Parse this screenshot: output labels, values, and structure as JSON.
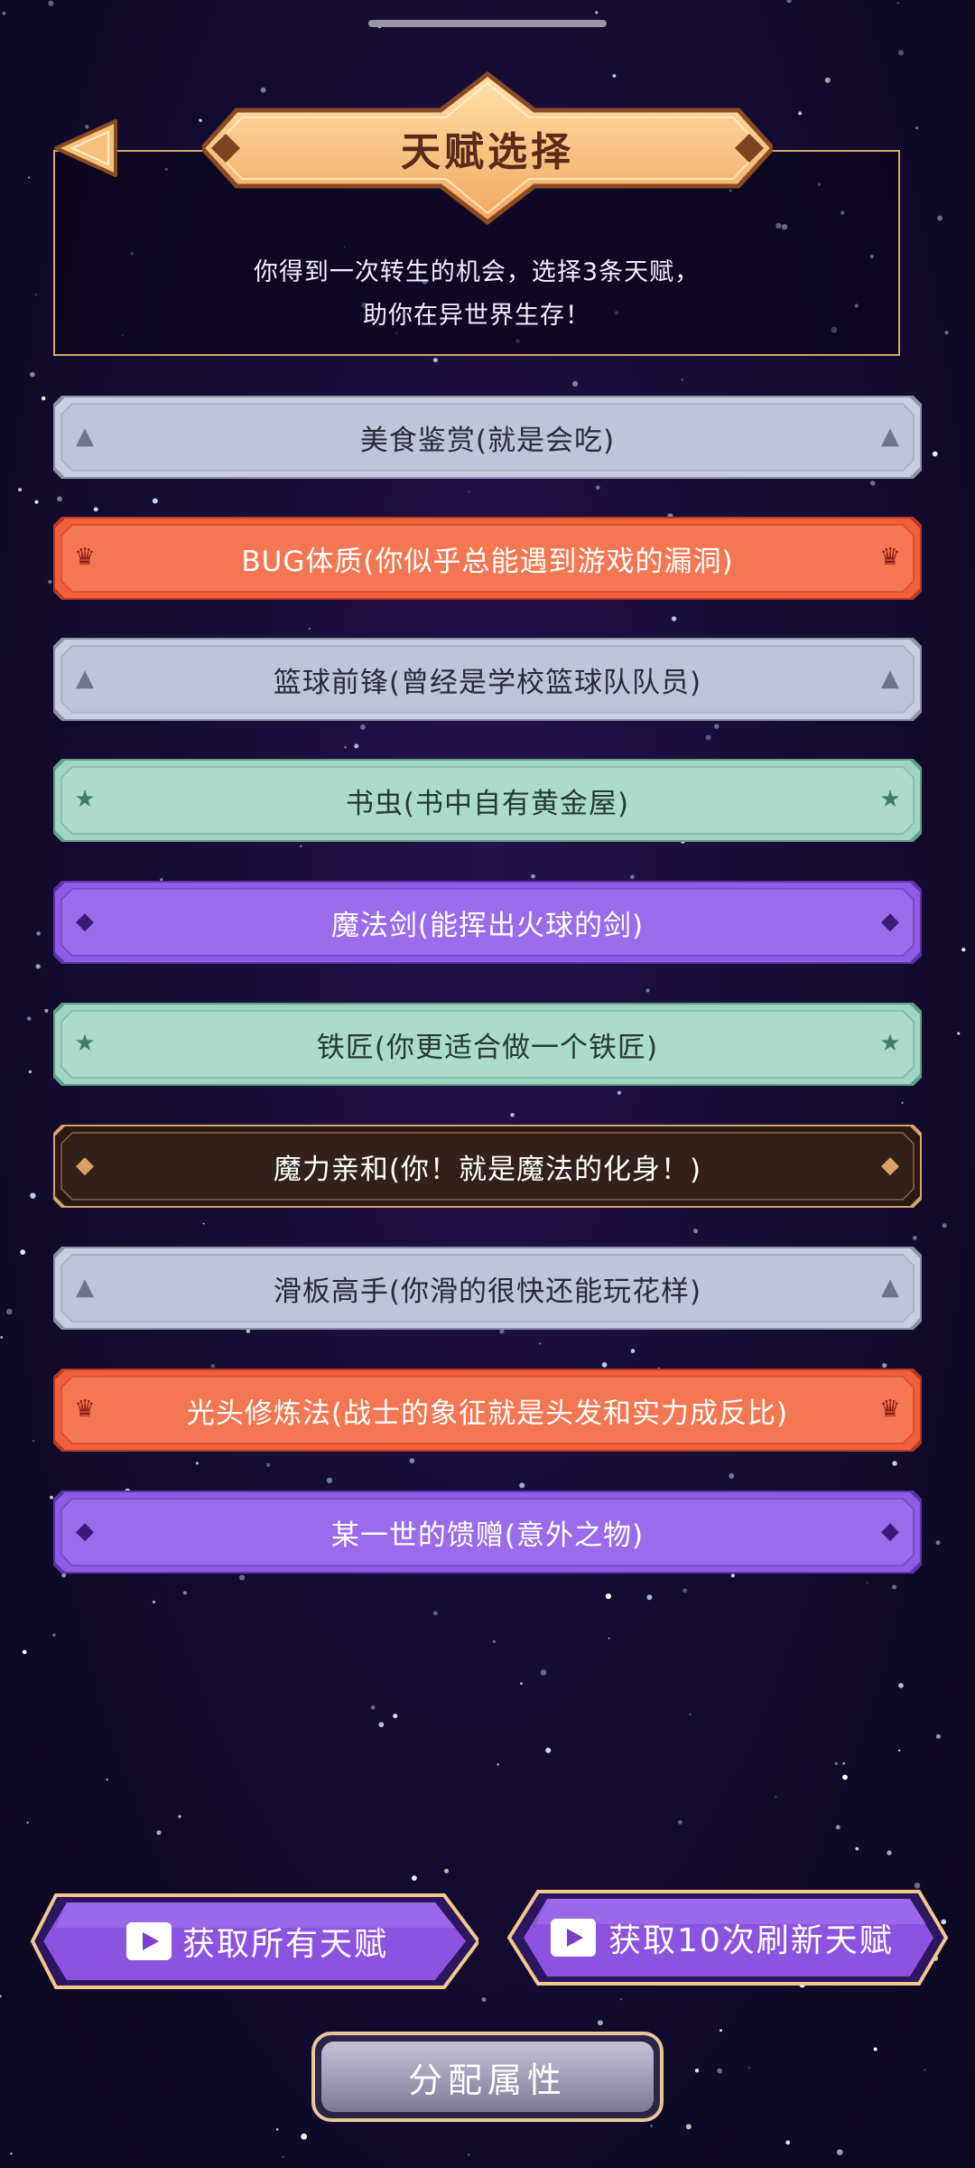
{
  "header": {
    "title": "天赋选择",
    "description_line1": "你得到一次转生的机会，选择3条天赋，",
    "description_line2": "助你在异世界生存！"
  },
  "talents": [
    {
      "label": "美食鉴赏(就是会吃)",
      "tier": "gray"
    },
    {
      "label": "BUG体质(你似乎总能遇到游戏的漏洞)",
      "tier": "orange"
    },
    {
      "label": "篮球前锋(曾经是学校篮球队队员)",
      "tier": "gray"
    },
    {
      "label": "书虫(书中自有黄金屋)",
      "tier": "teal"
    },
    {
      "label": "魔法剑(能挥出火球的剑)",
      "tier": "purple"
    },
    {
      "label": "铁匠(你更适合做一个铁匠)",
      "tier": "teal"
    },
    {
      "label": "魔力亲和(你！就是魔法的化身！)",
      "tier": "dark"
    },
    {
      "label": "滑板高手(你滑的很快还能玩花样)",
      "tier": "gray"
    },
    {
      "label": "光头修炼法(战士的象征就是头发和实力成反比)",
      "tier": "orange"
    },
    {
      "label": "某一世的馈赠(意外之物)",
      "tier": "purple"
    }
  ],
  "buttons": {
    "get_all_talents": "获取所有天赋",
    "get_refresh": "获取10次刷新天赋",
    "allocate": "分配属性"
  },
  "icons": {
    "gray": "triangle-icon",
    "orange": "crown-icon",
    "teal": "star-icon",
    "purple": "gem-icon",
    "dark": "diamond-icon",
    "back": "back-arrow-icon",
    "video": "video-play-icon"
  },
  "colors": {
    "gray": "#c9cde0",
    "orange": "#f0603c",
    "teal": "#9fd4c3",
    "purple": "#8e5ce6",
    "dark": "#2a1a16",
    "gold_border": "#d8a466",
    "title_plate": "#f7c583"
  }
}
